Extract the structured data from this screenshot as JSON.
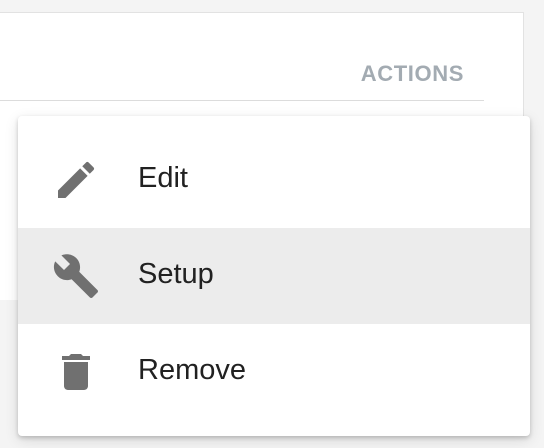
{
  "header": {
    "actions_label": "ACTIONS"
  },
  "menu": {
    "items": [
      {
        "label": "Edit",
        "icon": "pencil-icon"
      },
      {
        "label": "Setup",
        "icon": "wrench-icon"
      },
      {
        "label": "Remove",
        "icon": "trash-icon"
      }
    ],
    "highlighted_item": "Setup"
  },
  "colors": {
    "icon": "#707070",
    "highlight": "#ececec",
    "header_text": "#a3abb2"
  }
}
